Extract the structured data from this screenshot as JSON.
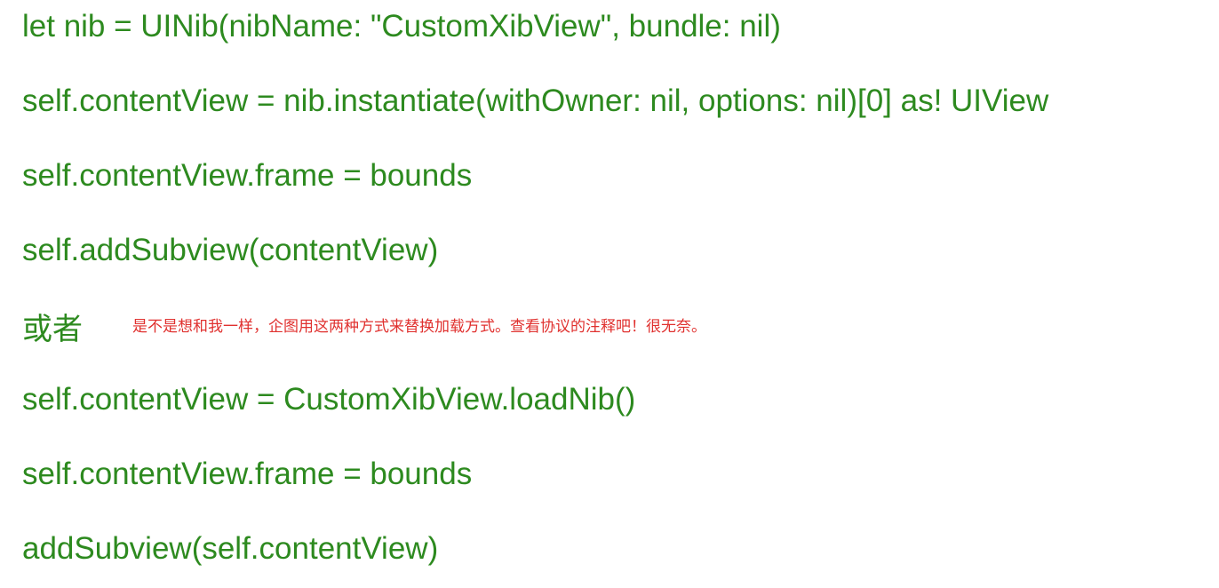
{
  "lines": {
    "l1": "let nib = UINib(nibName: \"CustomXibView\", bundle: nil)",
    "l2": "self.contentView = nib.instantiate(withOwner: nil, options: nil)[0] as! UIView",
    "l3": "self.contentView.frame = bounds",
    "l4": "self.addSubview(contentView)",
    "or": "或者",
    "note": "是不是想和我一样，企图用这两种方式来替换加载方式。查看协议的注释吧！很无奈。",
    "l6": "self.contentView = CustomXibView.loadNib()",
    "l7": "self.contentView.frame = bounds",
    "l8": "addSubview(self.contentView)"
  },
  "colors": {
    "code_text": "#2d8a1f",
    "note_text": "#e0312f",
    "background": "#ffffff"
  }
}
